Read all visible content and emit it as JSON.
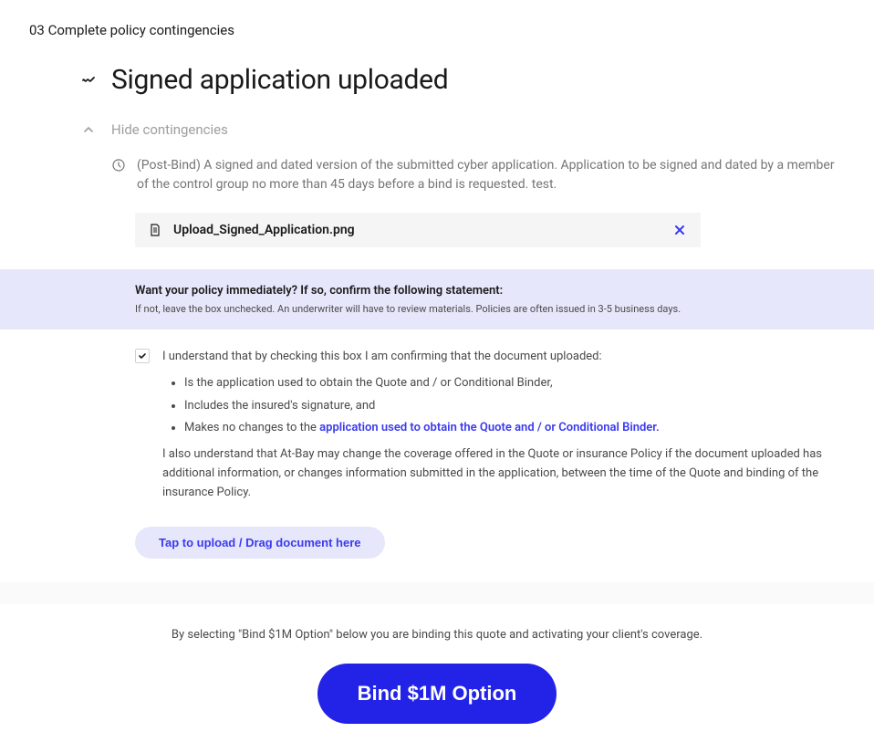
{
  "step_header": "03 Complete policy contingencies",
  "title": "Signed application uploaded",
  "toggle_label": "Hide contingencies",
  "description": "(Post-Bind) A signed and dated version of the submitted cyber application. Application to be signed and dated by a member of the control group no more than 45 days before a bind is requested. test.",
  "uploaded_file": {
    "name": "Upload_Signed_Application.png"
  },
  "confirm": {
    "title": "Want your policy immediately? If so, confirm the following statement:",
    "subtitle": "If not, leave the box unchecked. An underwriter will have to review materials. Policies are often issued in 3-5 business days."
  },
  "checkbox": {
    "checked": true,
    "intro": "I understand that by checking this box I am confirming that the document uploaded:",
    "items": [
      "Is the application used to obtain the Quote and / or Conditional Binder,",
      "Includes the insured's signature, and"
    ],
    "item3_prefix": "Makes no changes to the ",
    "item3_link": "application used to obtain the Quote and / or Conditional Binder.",
    "outro": "I also understand that At-Bay may change the coverage offered in the Quote or insurance Policy if the document uploaded has additional information, or changes information submitted in the application, between the time of the Quote and binding of the insurance Policy."
  },
  "upload_button_label": "Tap to upload / Drag document here",
  "bind": {
    "description": "By selecting \"Bind $1M Option\" below you are binding this quote and activating your client's coverage.",
    "button_label": "Bind $1M Option"
  }
}
